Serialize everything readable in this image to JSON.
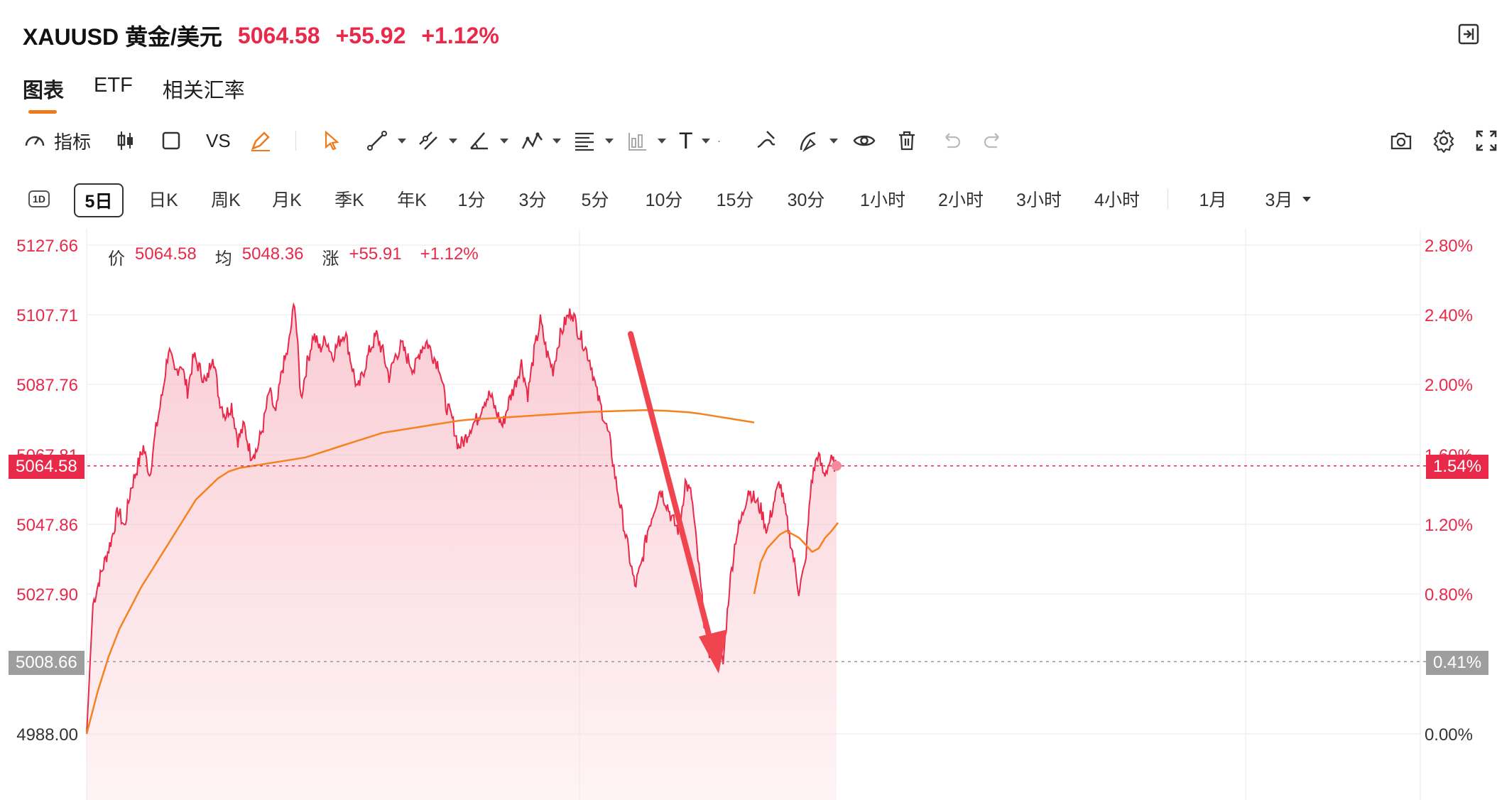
{
  "header": {
    "symbol": "XAUUSD 黄金/美元",
    "price": "5064.58",
    "change": "+55.92",
    "change_pct": "+1.12%"
  },
  "tabs": [
    "图表",
    "ETF",
    "相关汇率"
  ],
  "toolbar": {
    "indicators_label": "指标",
    "vs_label": "VS",
    "text_tool": "T"
  },
  "periods": {
    "icon_label": "1D",
    "items": [
      "5日",
      "日K",
      "周K",
      "月K",
      "季K",
      "年K",
      "1分",
      "3分",
      "5分",
      "10分",
      "15分",
      "30分",
      "1小时",
      "2小时",
      "3小时",
      "4小时",
      "1月",
      "3月"
    ],
    "active": "5日"
  },
  "legend": {
    "price_key": "价",
    "price": "5064.58",
    "avg_key": "均",
    "avg": "5048.36",
    "chg_key": "涨",
    "chg": "+55.91",
    "chg_pct": "+1.12%"
  },
  "axis": {
    "left_ticks": [
      "5127.66",
      "5107.71",
      "5087.76",
      "5067.81",
      "5047.86",
      "5027.90",
      "4988.00"
    ],
    "right_ticks": [
      "2.80%",
      "2.40%",
      "2.00%",
      "1.60%",
      "1.20%",
      "0.80%",
      "0.00%"
    ],
    "current_price": "5064.58",
    "current_pct": "1.54%",
    "ref_price": "5008.66",
    "ref_pct": "0.41%"
  },
  "colors": {
    "up": "#e8294a",
    "avg_line": "#f5821f",
    "accent": "#f07a1a",
    "ref_tag": "#9e9e9e",
    "arrow": "#f0444f"
  },
  "chart_data": {
    "type": "line",
    "y_range": [
      4988.0,
      5127.66
    ],
    "series": [
      {
        "values": [
          4988,
          5025,
          5032,
          5038,
          5044,
          5052,
          5047,
          5058,
          5064,
          5070,
          5062,
          5075,
          5085,
          5098,
          5091,
          5094,
          5086,
          5096,
          5092,
          5088,
          5097,
          5084,
          5079,
          5082,
          5072,
          5076,
          5068,
          5069,
          5076,
          5086,
          5079,
          5092,
          5098,
          5112,
          5084,
          5094,
          5102,
          5098,
          5101,
          5096,
          5100,
          5103,
          5094,
          5086,
          5092,
          5098,
          5102,
          5097,
          5090,
          5096,
          5099,
          5095,
          5092,
          5098,
          5100,
          5096,
          5093,
          5082,
          5078,
          5070,
          5072,
          5076,
          5078,
          5083,
          5085,
          5080,
          5076,
          5083,
          5088,
          5094,
          5085,
          5097,
          5106,
          5097,
          5092,
          5101,
          5106,
          5109,
          5103,
          5099,
          5094,
          5085,
          5079,
          5072,
          5060,
          5050,
          5040,
          5030,
          5036,
          5046,
          5052,
          5058,
          5054,
          5049,
          5046,
          5060,
          5056,
          5038,
          5020,
          5010,
          5014,
          5008,
          5030,
          5044,
          5050,
          5058,
          5055,
          5052,
          5046,
          5054,
          5060,
          5050,
          5040,
          5029,
          5036,
          5060,
          5068,
          5062,
          5066,
          5064.58
        ],
        "color": "#e8294a"
      },
      {
        "values": [
          4988,
          5000,
          5010,
          5018,
          5024,
          5030,
          5035,
          5040,
          5045,
          5050,
          5055,
          5058,
          5061,
          5063,
          5064,
          5064.5,
          5065,
          5065.5,
          5066,
          5066.5,
          5067,
          5068,
          5069,
          5070,
          5071,
          5072,
          5073,
          5074,
          5074.5,
          5075,
          5075.5,
          5076,
          5076.5,
          5077,
          5077.5,
          5077.8,
          5078,
          5078.2,
          5078.4,
          5078.6,
          5078.8,
          5079,
          5079.2,
          5079.4,
          5079.6,
          5079.8,
          5080,
          5080.1,
          5080.2,
          5080.3,
          5080.4,
          5080.5,
          5080.4,
          5080.3,
          5080.1,
          5079.9,
          5079.5,
          5079,
          5078.5,
          5078,
          5077.5,
          5077
        ],
        "color": "#f5821f"
      },
      {
        "values": [
          5028,
          5037,
          5041,
          5043,
          5045,
          5046,
          5045,
          5044,
          5042,
          5040,
          5041,
          5044,
          5046,
          5048.36
        ],
        "color": "#f5821f"
      }
    ]
  }
}
